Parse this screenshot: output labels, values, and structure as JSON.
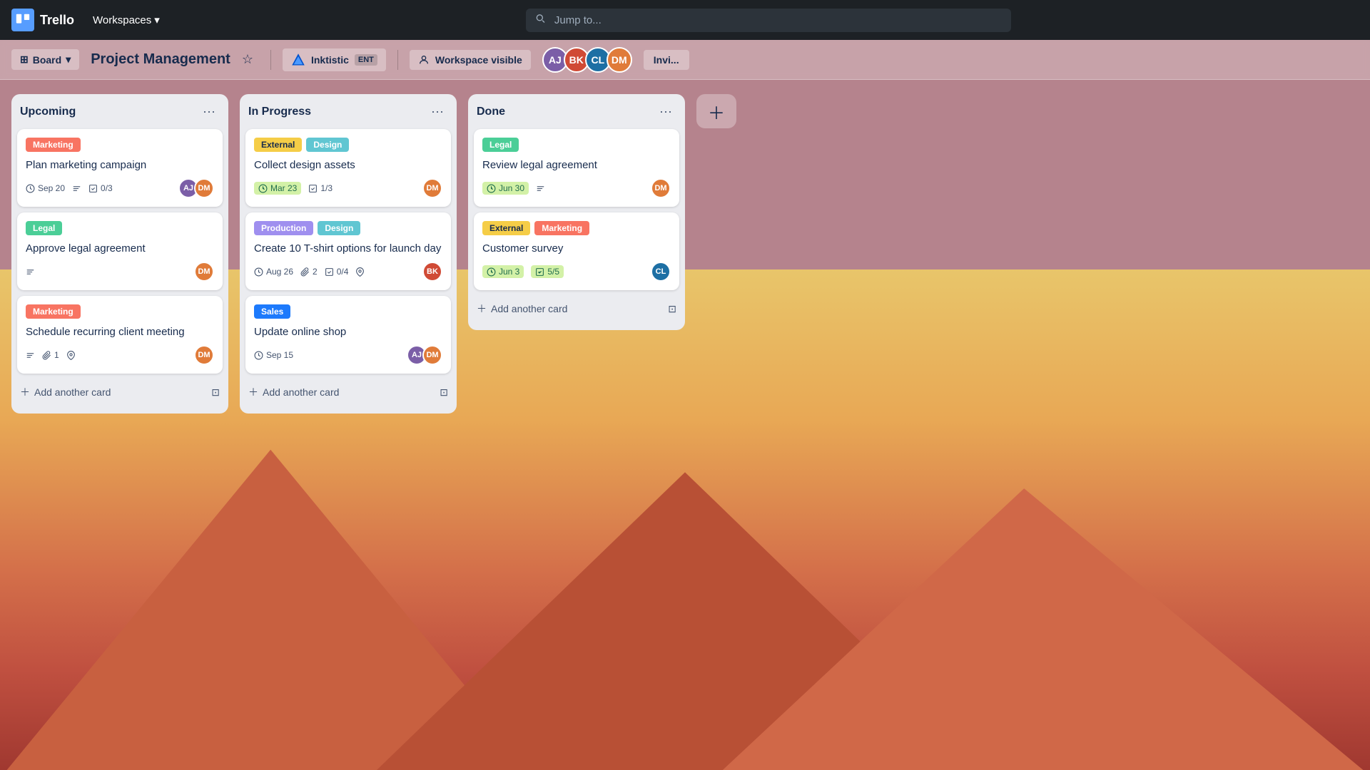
{
  "app": {
    "name": "Trello",
    "nav": {
      "workspaces_label": "Workspaces",
      "search_placeholder": "Jump to..."
    }
  },
  "board": {
    "title": "Project Management",
    "view_label": "Board",
    "star_title": "Star this board",
    "workspace": {
      "name": "Inktistic",
      "badge": "ENT"
    },
    "visibility": "Workspace visible",
    "invite_label": "Invi...",
    "members": [
      {
        "id": "m1",
        "color": "#7b5ea7",
        "initials": "AJ"
      },
      {
        "id": "m2",
        "color": "#d04a35",
        "initials": "BK"
      },
      {
        "id": "m3",
        "color": "#1d6fa4",
        "initials": "CL"
      },
      {
        "id": "m4",
        "color": "#e07b39",
        "initials": "DM"
      }
    ]
  },
  "lists": [
    {
      "id": "upcoming",
      "title": "Upcoming",
      "add_card_label": "Add another card",
      "cards": [
        {
          "id": "c1",
          "labels": [
            {
              "text": "Marketing",
              "class": "label-orange"
            }
          ],
          "title": "Plan marketing campaign",
          "meta": [
            {
              "type": "date",
              "value": "Sep 20"
            },
            {
              "type": "description"
            },
            {
              "type": "checklist",
              "value": "0/3"
            }
          ],
          "avatars": [
            {
              "color": "#7b5ea7",
              "initials": "AJ"
            },
            {
              "color": "#e07b39",
              "initials": "DM"
            }
          ]
        },
        {
          "id": "c2",
          "labels": [
            {
              "text": "Legal",
              "class": "label-green"
            }
          ],
          "title": "Approve legal agreement",
          "meta": [
            {
              "type": "description"
            }
          ],
          "avatars": [
            {
              "color": "#e07b39",
              "initials": "DM"
            }
          ]
        },
        {
          "id": "c3",
          "labels": [
            {
              "text": "Marketing",
              "class": "label-orange"
            }
          ],
          "title": "Schedule recurring client meeting",
          "meta": [
            {
              "type": "description"
            },
            {
              "type": "attachment",
              "value": "1"
            },
            {
              "type": "location"
            }
          ],
          "avatars": [
            {
              "color": "#e07b39",
              "initials": "DM"
            }
          ]
        }
      ]
    },
    {
      "id": "inprogress",
      "title": "In Progress",
      "add_card_label": "Add another card",
      "cards": [
        {
          "id": "c4",
          "labels": [
            {
              "text": "External",
              "class": "label-yellow"
            },
            {
              "text": "Design",
              "class": "label-teal"
            }
          ],
          "title": "Collect design assets",
          "meta": [
            {
              "type": "date",
              "value": "Mar 23",
              "green": true
            },
            {
              "type": "checklist",
              "value": "1/3"
            }
          ],
          "avatars": [
            {
              "color": "#e07b39",
              "initials": "DM"
            }
          ]
        },
        {
          "id": "c5",
          "labels": [
            {
              "text": "Production",
              "class": "label-purple"
            },
            {
              "text": "Design",
              "class": "label-teal"
            }
          ],
          "title": "Create 10 T-shirt options for launch day",
          "meta": [
            {
              "type": "date",
              "value": "Aug 26"
            },
            {
              "type": "attachment",
              "value": "2"
            },
            {
              "type": "checklist",
              "value": "0/4"
            },
            {
              "type": "location"
            }
          ],
          "avatars": [
            {
              "color": "#d04a35",
              "initials": "BK"
            }
          ]
        },
        {
          "id": "c6",
          "labels": [
            {
              "text": "Sales",
              "class": "label-sales"
            }
          ],
          "title": "Update online shop",
          "meta": [
            {
              "type": "date",
              "value": "Sep 15"
            }
          ],
          "avatars": [
            {
              "color": "#7b5ea7",
              "initials": "AJ"
            },
            {
              "color": "#e07b39",
              "initials": "DM"
            }
          ]
        }
      ]
    },
    {
      "id": "done",
      "title": "Done",
      "add_card_label": "Add another card",
      "cards": [
        {
          "id": "c7",
          "labels": [
            {
              "text": "Legal",
              "class": "label-green"
            }
          ],
          "title": "Review legal agreement",
          "meta": [
            {
              "type": "date",
              "value": "Jun 30",
              "green": true
            },
            {
              "type": "description"
            }
          ],
          "avatars": [
            {
              "color": "#e07b39",
              "initials": "DM"
            }
          ]
        },
        {
          "id": "c8",
          "labels": [
            {
              "text": "External",
              "class": "label-yellow"
            },
            {
              "text": "Marketing",
              "class": "label-orange"
            }
          ],
          "title": "Customer survey",
          "meta": [
            {
              "type": "date",
              "value": "Jun 3",
              "green": true
            },
            {
              "type": "checklist",
              "value": "5/5",
              "green": true
            }
          ],
          "avatars": [
            {
              "color": "#1d6fa4",
              "initials": "CL"
            }
          ]
        }
      ]
    }
  ]
}
